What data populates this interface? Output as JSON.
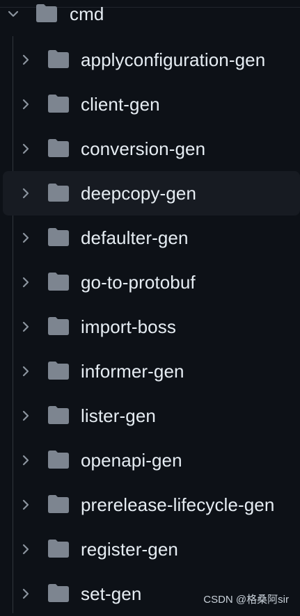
{
  "tree": {
    "root": {
      "label": "cmd",
      "icon": "folder-icon",
      "expanded": true
    },
    "items": [
      {
        "label": "applyconfiguration-gen",
        "icon": "folder-icon"
      },
      {
        "label": "client-gen",
        "icon": "folder-icon"
      },
      {
        "label": "conversion-gen",
        "icon": "folder-icon"
      },
      {
        "label": "deepcopy-gen",
        "icon": "folder-icon",
        "selected": true
      },
      {
        "label": "defaulter-gen",
        "icon": "folder-icon"
      },
      {
        "label": "go-to-protobuf",
        "icon": "folder-icon"
      },
      {
        "label": "import-boss",
        "icon": "folder-icon"
      },
      {
        "label": "informer-gen",
        "icon": "folder-icon"
      },
      {
        "label": "lister-gen",
        "icon": "folder-icon"
      },
      {
        "label": "openapi-gen",
        "icon": "folder-icon"
      },
      {
        "label": "prerelease-lifecycle-gen",
        "icon": "folder-icon"
      },
      {
        "label": "register-gen",
        "icon": "folder-icon"
      },
      {
        "label": "set-gen",
        "icon": "folder-icon"
      }
    ]
  },
  "watermark": "CSDN @格桑阿sir",
  "colors": {
    "background": "#0d1117",
    "text": "#e6edf3",
    "folder": "#7d8590",
    "chevron": "#8b949e",
    "selected_row": "#171b22",
    "indent_guide": "#30363d"
  }
}
